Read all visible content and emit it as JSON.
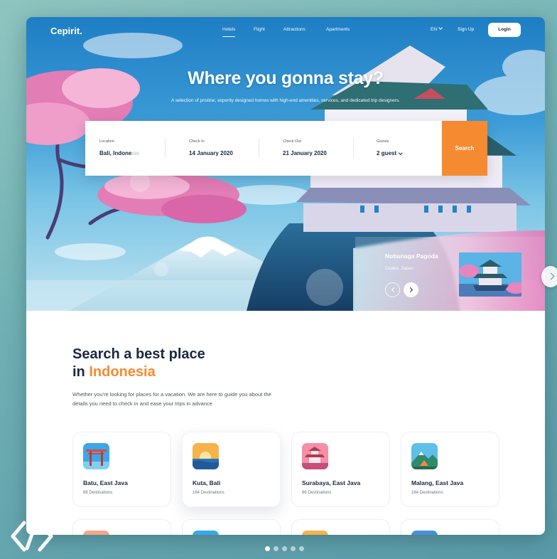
{
  "app": {
    "logo": "Cepirit.",
    "nav": {
      "links": [
        "Hotels",
        "Flight",
        "Attractions",
        "Apartments"
      ],
      "active": "Hotels",
      "language": "EN",
      "signup": "Sign Up",
      "login": "Login"
    }
  },
  "hero": {
    "title": "Where you gonna stay?",
    "subtitle": "A selection of pristine, expertly designed homes with high-end amenities, services, and dedicated trip designers."
  },
  "search": {
    "location": {
      "label": "Location",
      "value": "Bali, Indone",
      "value_fade": "sia"
    },
    "checkin": {
      "label": "Check In",
      "value": "14 January 2020"
    },
    "checkout": {
      "label": "Check Out",
      "value": "21 January 2020"
    },
    "guests": {
      "label": "Guests",
      "value": "2 guest"
    },
    "button": "Search"
  },
  "featured": {
    "title": "Nobunaga Pagoda",
    "subtitle": "Osaka, Japan"
  },
  "section": {
    "heading_line1": "Search a best place",
    "heading_prefix": "in ",
    "heading_highlight": "Indonesia",
    "description": "Whether you're looking for places for a vacation. We are here to guide you about the details you need to check in and ease your trips in advance"
  },
  "destinations": [
    {
      "name": "Batu, East Java",
      "count": "88 Destinations",
      "icon": "torii-gate-icon"
    },
    {
      "name": "Kuta, Bali",
      "count": "164 Destinations",
      "icon": "sunset-sea-icon"
    },
    {
      "name": "Surabaya, East Java",
      "count": "86 Destinations",
      "icon": "pagoda-icon"
    },
    {
      "name": "Malang, East Java",
      "count": "164 Destinations",
      "icon": "mountain-camp-icon"
    }
  ],
  "carousel": {
    "slides": 5,
    "active_index": 0
  },
  "colors": {
    "accent": "#f58a31",
    "dark_text": "#1a2740",
    "sky": "#3b9bd6",
    "blossom": "#e87fb5"
  }
}
